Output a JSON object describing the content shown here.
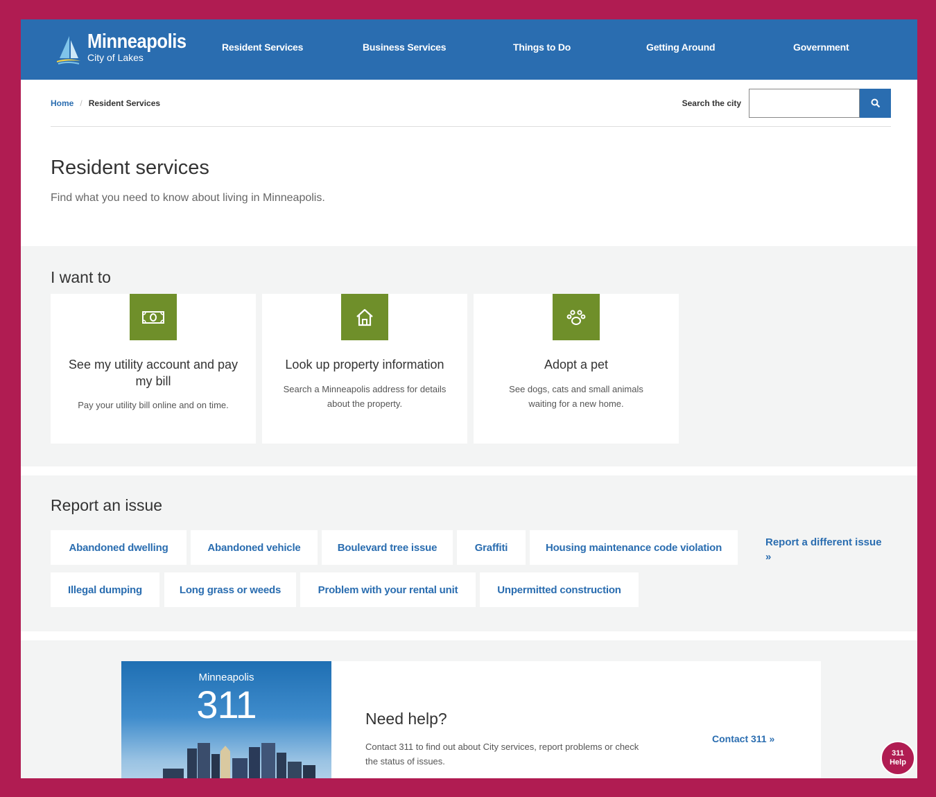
{
  "header": {
    "logo_name": "Minneapolis",
    "logo_tagline": "City of Lakes",
    "nav": [
      "Resident Services",
      "Business Services",
      "Things to Do",
      "Getting Around",
      "Government"
    ]
  },
  "breadcrumb": {
    "home": "Home",
    "separator": "/",
    "current": "Resident Services"
  },
  "search": {
    "label": "Search the city",
    "placeholder": ""
  },
  "page": {
    "title": "Resident services",
    "subtitle": "Find what you need to know about living in Minneapolis."
  },
  "want": {
    "heading": "I want to",
    "cards": [
      {
        "icon": "money-icon",
        "title": "See my utility account and pay my bill",
        "desc": "Pay your utility bill online and on time."
      },
      {
        "icon": "house-icon",
        "title": "Look up property information",
        "desc": "Search a Minneapolis address for details about the property."
      },
      {
        "icon": "paw-icon",
        "title": "Adopt a pet",
        "desc": "See dogs, cats and small animals waiting for a new home."
      }
    ]
  },
  "report": {
    "heading": "Report an issue",
    "issues": [
      "Abandoned dwelling",
      "Abandoned vehicle",
      "Boulevard tree issue",
      "Graffiti",
      "Housing maintenance code violation",
      "Illegal dumping",
      "Long grass or weeds",
      "Problem with your rental unit",
      "Unpermitted construction"
    ],
    "different": "Report a different issue »"
  },
  "help": {
    "image_city": "Minneapolis",
    "image_number": "311",
    "title": "Need help?",
    "desc": "Contact 311 to find out about City services, report problems or check the status of issues.",
    "contact": "Contact 311 »"
  },
  "fab": {
    "line1": "311",
    "line2": "Help"
  },
  "colors": {
    "brand_blue": "#2a6db0",
    "accent_green": "#6f8f2a",
    "frame_magenta": "#b01c52",
    "section_gray": "#f3f4f4"
  }
}
